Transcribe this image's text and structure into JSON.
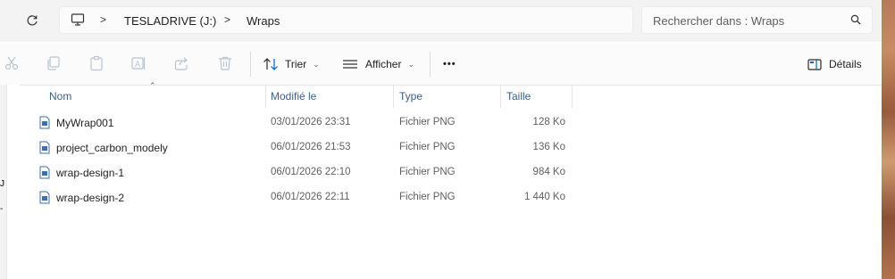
{
  "address": {
    "crumbs": [
      "TESLADRIVE (J:)",
      "Wraps"
    ],
    "separator": ">"
  },
  "search": {
    "placeholder": "Rechercher dans : Wraps"
  },
  "toolbar": {
    "icons": [
      "cut-icon",
      "copy-icon",
      "paste-icon",
      "rename-icon",
      "share-icon",
      "delete-icon"
    ],
    "sort_label": "Trier",
    "view_label": "Afficher",
    "more_label": "•••",
    "details_label": "Détails"
  },
  "columns": {
    "name": "Nom",
    "modified": "Modifié le",
    "type": "Type",
    "size": "Taille"
  },
  "files": [
    {
      "name": "MyWrap001",
      "modified": "03/01/2026 23:31",
      "type": "Fichier PNG",
      "size": "128 Ko"
    },
    {
      "name": "project_carbon_modely",
      "modified": "06/01/2026 21:53",
      "type": "Fichier PNG",
      "size": "136 Ko"
    },
    {
      "name": "wrap-design-1",
      "modified": "06/01/2026 22:10",
      "type": "Fichier PNG",
      "size": "984 Ko"
    },
    {
      "name": "wrap-design-2",
      "modified": "06/01/2026 22:11",
      "type": "Fichier PNG",
      "size": "1 440 Ko"
    }
  ],
  "left_pane_chars": [
    "J",
    "-"
  ],
  "colors": {
    "header_text": "#3a5f8a",
    "accent": "#0067c0"
  }
}
